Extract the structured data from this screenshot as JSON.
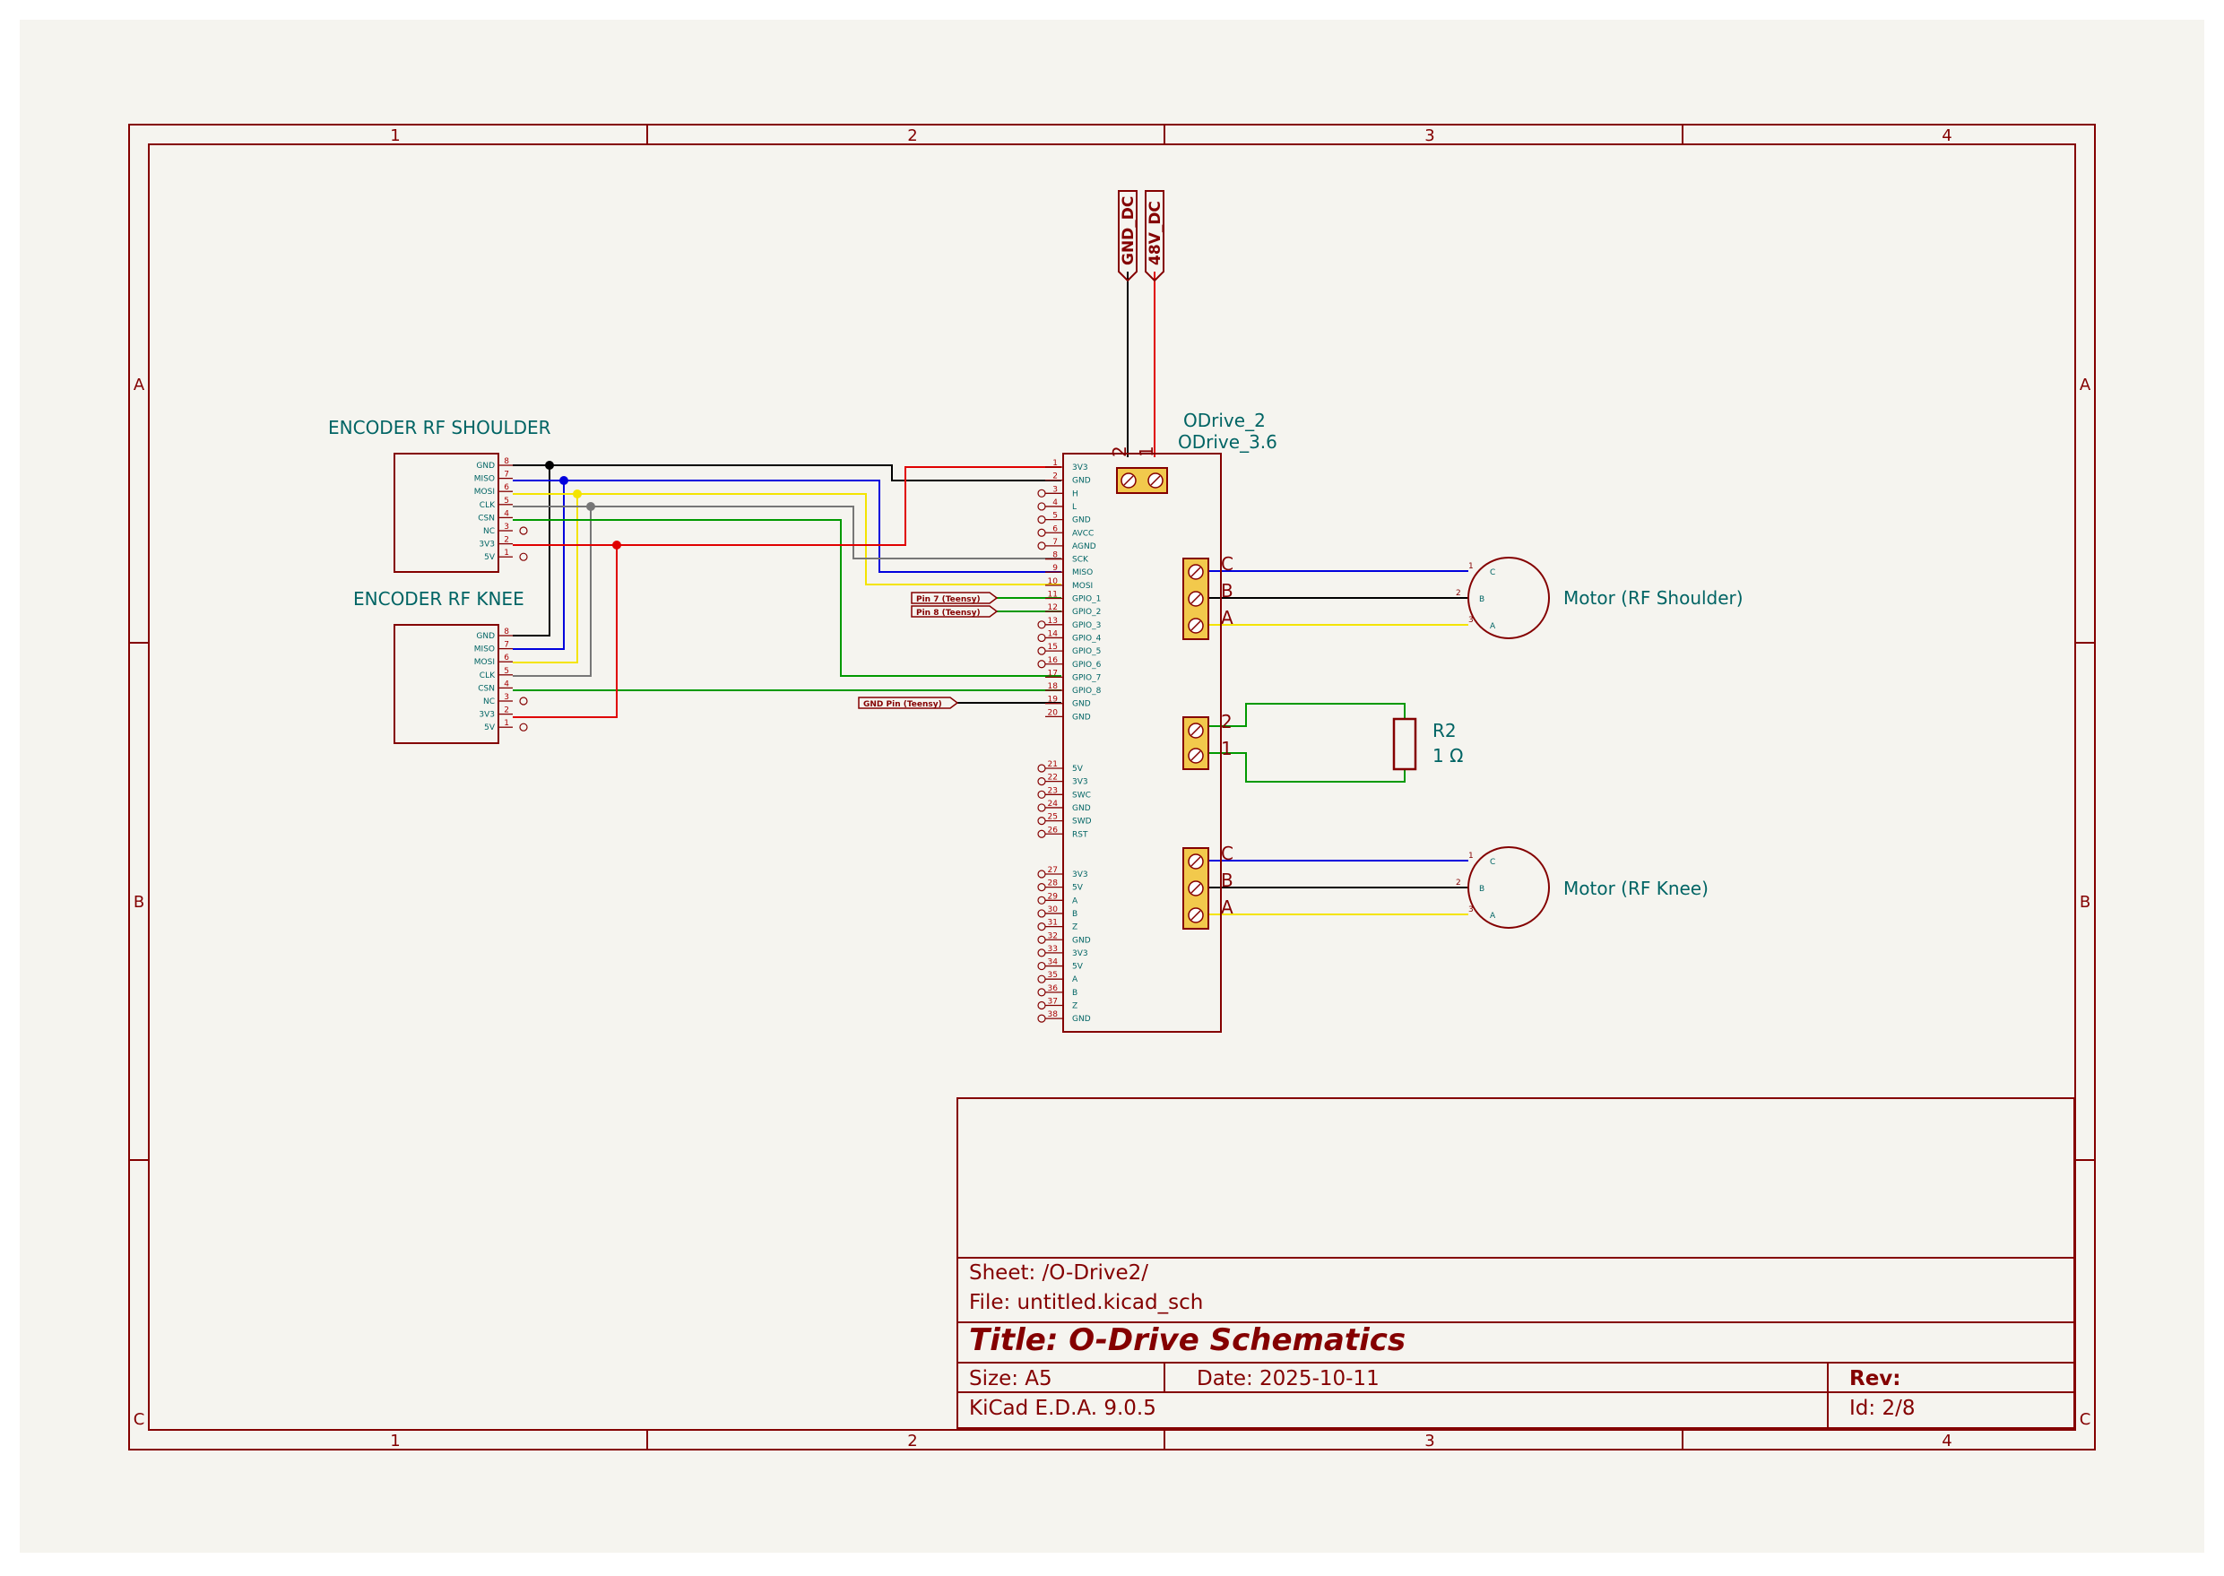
{
  "encoder_shoulder": {
    "title": "ENCODER RF SHOULDER",
    "pins": [
      {
        "num": "8",
        "name": "GND"
      },
      {
        "num": "7",
        "name": "MISO"
      },
      {
        "num": "6",
        "name": "MOSI"
      },
      {
        "num": "5",
        "name": "CLK"
      },
      {
        "num": "4",
        "name": "CSN"
      },
      {
        "num": "3",
        "name": "NC"
      },
      {
        "num": "2",
        "name": "3V3"
      },
      {
        "num": "1",
        "name": "5V"
      }
    ]
  },
  "encoder_knee": {
    "title": "ENCODER RF KNEE",
    "pins": [
      {
        "num": "8",
        "name": "GND"
      },
      {
        "num": "7",
        "name": "MISO"
      },
      {
        "num": "6",
        "name": "MOSI"
      },
      {
        "num": "5",
        "name": "CLK"
      },
      {
        "num": "4",
        "name": "CSN"
      },
      {
        "num": "3",
        "name": "NC"
      },
      {
        "num": "2",
        "name": "3V3"
      },
      {
        "num": "1",
        "name": "5V"
      }
    ]
  },
  "odrive": {
    "ref": "ODrive_2",
    "value": "ODrive_3.6",
    "pins": [
      {
        "num": "1",
        "name": "3V3"
      },
      {
        "num": "2",
        "name": "GND"
      },
      {
        "num": "3",
        "name": "H"
      },
      {
        "num": "4",
        "name": "L"
      },
      {
        "num": "5",
        "name": "GND"
      },
      {
        "num": "6",
        "name": "AVCC"
      },
      {
        "num": "7",
        "name": "AGND"
      },
      {
        "num": "8",
        "name": "SCK"
      },
      {
        "num": "9",
        "name": "MISO"
      },
      {
        "num": "10",
        "name": "MOSI"
      },
      {
        "num": "11",
        "name": "GPIO_1"
      },
      {
        "num": "12",
        "name": "GPIO_2"
      },
      {
        "num": "13",
        "name": "GPIO_3"
      },
      {
        "num": "14",
        "name": "GPIO_4"
      },
      {
        "num": "15",
        "name": "GPIO_5"
      },
      {
        "num": "16",
        "name": "GPIO_6"
      },
      {
        "num": "17",
        "name": "GPIO_7"
      },
      {
        "num": "18",
        "name": "GPIO_8"
      },
      {
        "num": "19",
        "name": "GND"
      },
      {
        "num": "20",
        "name": "GND"
      },
      {
        "num": "21",
        "name": "5V"
      },
      {
        "num": "22",
        "name": "3V3"
      },
      {
        "num": "23",
        "name": "SWC"
      },
      {
        "num": "24",
        "name": "GND"
      },
      {
        "num": "25",
        "name": "SWD"
      },
      {
        "num": "26",
        "name": "RST"
      },
      {
        "num": "27",
        "name": "3V3"
      },
      {
        "num": "28",
        "name": "5V"
      },
      {
        "num": "29",
        "name": "A"
      },
      {
        "num": "30",
        "name": "B"
      },
      {
        "num": "31",
        "name": "Z"
      },
      {
        "num": "32",
        "name": "GND"
      },
      {
        "num": "33",
        "name": "3V3"
      },
      {
        "num": "34",
        "name": "5V"
      },
      {
        "num": "35",
        "name": "A"
      },
      {
        "num": "36",
        "name": "B"
      },
      {
        "num": "37",
        "name": "Z"
      },
      {
        "num": "38",
        "name": "GND"
      }
    ],
    "power_terminal_pins": [
      "2",
      "1"
    ]
  },
  "power_labels": [
    "GND_DC",
    "48V_DC"
  ],
  "net_labels": [
    "Pin 7 (Teensy)",
    "Pin 8 (Teensy)",
    "GND Pin (Teensy)"
  ],
  "motor_shoulder": {
    "label": "Motor (RF Shoulder)",
    "phases": [
      "C",
      "B",
      "A"
    ],
    "pins": [
      "1",
      "2",
      "3"
    ]
  },
  "motor_knee": {
    "label": "Motor (RF Knee)",
    "phases": [
      "C",
      "B",
      "A"
    ],
    "pins": [
      "1",
      "2",
      "3"
    ]
  },
  "resistor": {
    "ref": "R2",
    "value": "1 Ω",
    "terminal_pins": [
      "2",
      "1"
    ]
  },
  "frame": {
    "columns": [
      "1",
      "2",
      "3",
      "4"
    ],
    "rows": [
      "A",
      "B",
      "C"
    ]
  },
  "title_block": {
    "sheet": "Sheet: /O-Drive2/",
    "file": "File: untitled.kicad_sch",
    "title": "Title: O-Drive Schematics",
    "size": "Size: A5",
    "date": "Date: 2025-10-11",
    "rev": "Rev:",
    "tool": "KiCad E.D.A. 9.0.5",
    "id": "Id: 2/8"
  },
  "colors": {
    "background": "#f5f4ef",
    "frame": "#840000",
    "text_teal": "#006464",
    "wire_black": "#000000",
    "wire_red": "#e00000",
    "wire_blue": "#0000dd",
    "wire_yellow": "#f4e400",
    "wire_gray": "#777777",
    "wire_green": "#009900",
    "terminal_fill": "#f2c94c"
  }
}
